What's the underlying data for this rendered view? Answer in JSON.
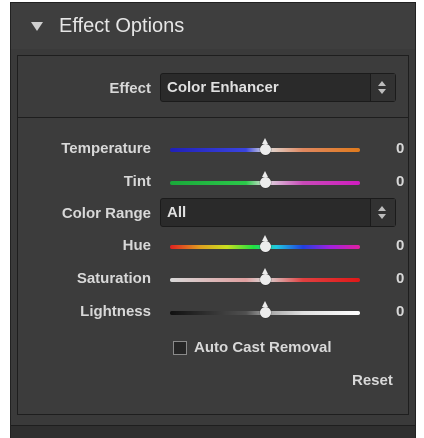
{
  "panel": {
    "title": "Effect Options"
  },
  "effect": {
    "label": "Effect",
    "value": "Color Enhancer"
  },
  "sliders": [
    {
      "label": "Temperature",
      "value": "0",
      "gradient": "linear-gradient(to right, #2020b8, #3a44e0 40%, #e0e0e0 50%, #e08860 70%, #e07a1c)",
      "position": 0.5
    },
    {
      "label": "Tint",
      "value": "0",
      "gradient": "linear-gradient(to right, #1aa83a, #2cc84a 40%, #e0e0e0 50%, #c84ab8 70%, #d01cc0)",
      "position": 0.5
    },
    {
      "label": "Hue",
      "value": "0",
      "gradient": "linear-gradient(to right, #e02020, #e0a020 16%, #c8e020 30%, #20e040 44%, #20c8e0 56%, #2040e0 70%, #a020e0 84%, #e020a0)",
      "position": 0.5
    },
    {
      "label": "Saturation",
      "value": "0",
      "gradient": "linear-gradient(to right, #d8d8d8, #e0a0a0 40%, #d8d8d8 50%, #e04040 70%, #e01818)",
      "position": 0.5
    },
    {
      "label": "Lightness",
      "value": "0",
      "gradient": "linear-gradient(to right, #101010, #505050 40%, #a0a0a0 50%, #e0e0e0 70%, #ffffff)",
      "position": 0.5
    }
  ],
  "color_range": {
    "label": "Color Range",
    "value": "All"
  },
  "auto_cast": {
    "label": "Auto Cast Removal",
    "checked": false
  },
  "reset": {
    "label": "Reset"
  }
}
